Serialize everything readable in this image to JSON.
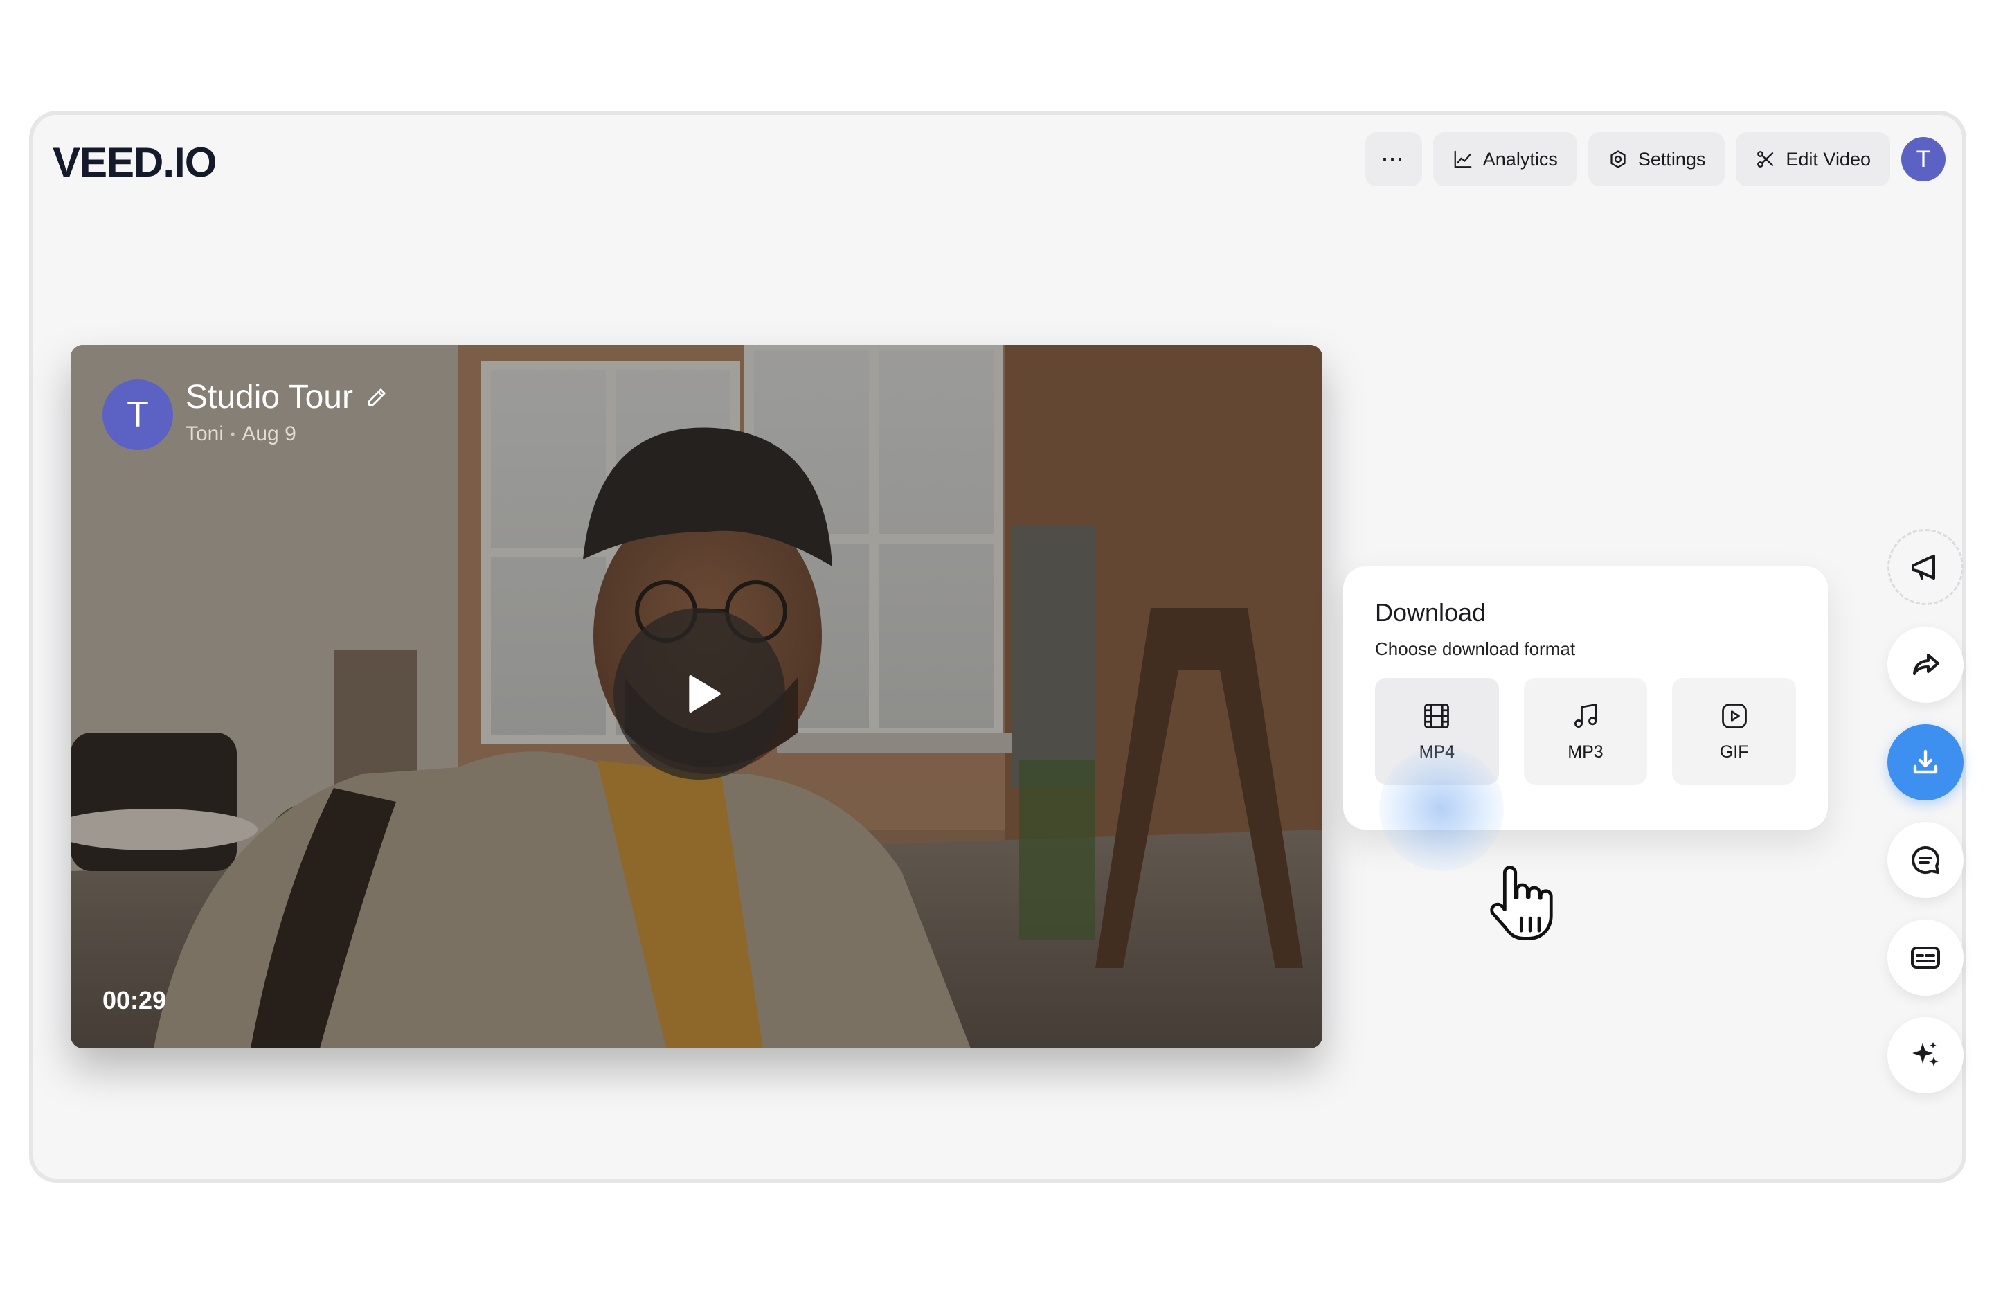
{
  "app": {
    "logo": "VEED.IO"
  },
  "topbar": {
    "more_label": "···",
    "analytics_label": "Analytics",
    "settings_label": "Settings",
    "edit_label": "Edit Video",
    "avatar_initial": "T"
  },
  "video": {
    "avatar_initial": "T",
    "title": "Studio Tour",
    "author": "Toni",
    "separator": "•",
    "date": "Aug 9",
    "duration": "00:29"
  },
  "download": {
    "title": "Download",
    "subtitle": "Choose download format",
    "options": [
      {
        "label": "MP4",
        "icon": "film-icon"
      },
      {
        "label": "MP3",
        "icon": "music-note-icon"
      },
      {
        "label": "GIF",
        "icon": "play-square-icon"
      }
    ],
    "selected": "MP4"
  },
  "side_actions": [
    {
      "icon": "megaphone-icon"
    },
    {
      "icon": "share-arrow-icon"
    },
    {
      "icon": "download-icon",
      "active": true
    },
    {
      "icon": "comment-icon"
    },
    {
      "icon": "captions-icon"
    },
    {
      "icon": "sparkles-icon"
    }
  ],
  "colors": {
    "accent": "#3d8ff0",
    "avatar": "#5b62c4",
    "window_bg": "#f6f6f7"
  }
}
